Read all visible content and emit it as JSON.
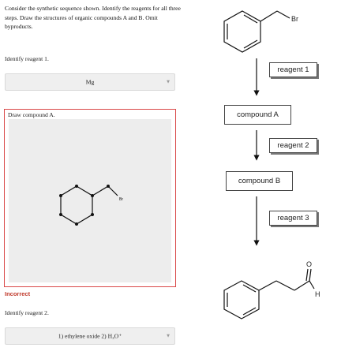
{
  "question": {
    "prompt": "Consider the synthetic sequence shown. Identify the reagents for all three steps. Draw the structures of organic compounds A and B. Omit byproducts."
  },
  "step1": {
    "label": "Identify reagent 1.",
    "selected": "Mg"
  },
  "draw": {
    "label": "Draw compound A.",
    "structure_atom_label": "Br",
    "status": "Incorrect"
  },
  "step2": {
    "label": "Identify reagent 2.",
    "selected": "1) ethylene oxide 2) H₃O⁺"
  },
  "scheme": {
    "start_atom_label": "Br",
    "reagent1": "reagent 1",
    "compoundA": "compound A",
    "reagent2": "reagent 2",
    "compoundB": "compound B",
    "reagent3": "reagent 3",
    "product_o_label": "O",
    "product_h_label": "H"
  },
  "colors": {
    "error": "#d94848",
    "incorrect_text": "#c0392b",
    "select_bg": "#efefef"
  }
}
